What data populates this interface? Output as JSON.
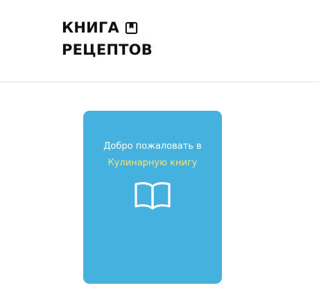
{
  "header": {
    "logo_line1": "КНИГА",
    "logo_line2": "РЕЦЕПТОВ",
    "logo_icon": "bookmark-icon"
  },
  "card": {
    "welcome_text": "Добро пожаловать в",
    "welcome_accent": "Кулинарную книгу",
    "icon": "open-book-icon",
    "background_color": "#45b1de",
    "accent_color": "#f3e67a"
  }
}
